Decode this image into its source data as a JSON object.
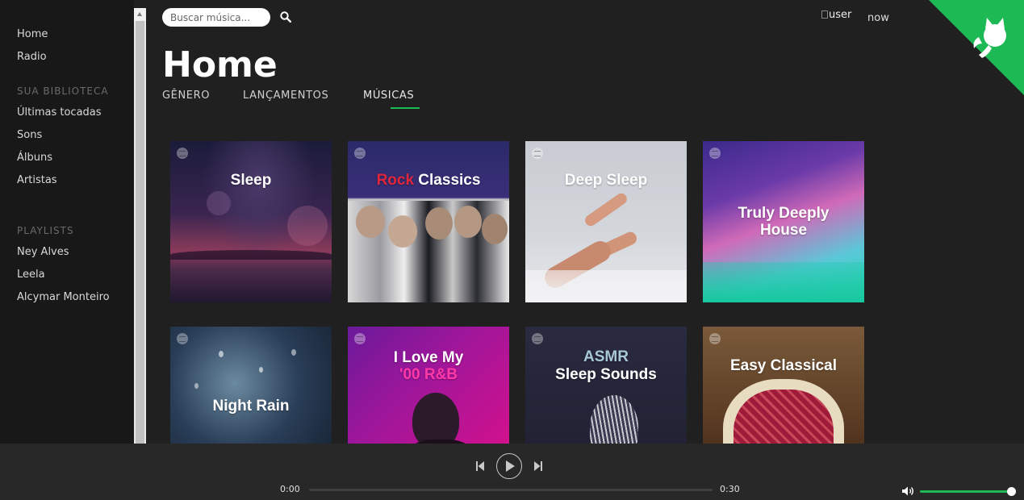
{
  "sidebar": {
    "nav": [
      "Home",
      "Radio"
    ],
    "library_heading": "SUA BIBLIOTECA",
    "library_items": [
      "Últimas tocadas",
      "Sons",
      "Álbuns",
      "Artistas"
    ],
    "playlists_heading": "PLAYLISTS",
    "playlists": [
      "Ney Alves",
      "Leela",
      "Alcymar Monteiro"
    ]
  },
  "search": {
    "placeholder": "Buscar música...",
    "icon": "search-icon"
  },
  "user": {
    "image_alt": "user",
    "status": "now"
  },
  "main": {
    "title": "Home",
    "tabs": [
      {
        "label": "GÊNERO"
      },
      {
        "label": "LANÇAMENTOS"
      },
      {
        "label": "MÚSICAS",
        "active": true
      }
    ]
  },
  "playlist_cards": [
    {
      "title_line1": "Sleep",
      "title_line2": ""
    },
    {
      "title_highlight": "Rock",
      "title_rest": " Classics"
    },
    {
      "title_line1": "Deep Sleep",
      "title_line2": ""
    },
    {
      "title_line1": "Truly Deeply",
      "title_line2": "House"
    },
    {
      "title_line1": "Night Rain",
      "title_line2": ""
    },
    {
      "title_line1": "I Love My",
      "title_line2": "'00 R&B"
    },
    {
      "title_line1": "ASMR",
      "title_line2": "Sleep Sounds"
    },
    {
      "title_line1": "Easy Classical",
      "title_line2": ""
    }
  ],
  "player": {
    "current_time": "0:00",
    "total_time": "0:30",
    "progress": 0.0,
    "volume": 1.0,
    "controls": [
      "skip-back-icon",
      "play-icon",
      "skip-forward-icon"
    ]
  },
  "colors": {
    "accent": "#1db954",
    "sidebar_bg": "#181818",
    "main_bg": "#202020",
    "player_bg": "#282828"
  }
}
